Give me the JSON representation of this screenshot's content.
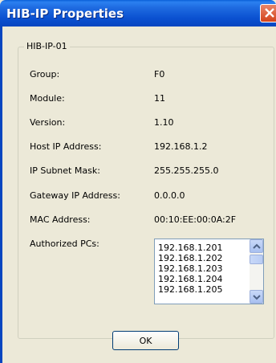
{
  "window": {
    "title": "HIB-IP Properties"
  },
  "group": {
    "caption": "HIB-IP-01",
    "fields": [
      {
        "label": "Group:",
        "value": "F0"
      },
      {
        "label": "Module:",
        "value": "11"
      },
      {
        "label": "Version:",
        "value": "1.10"
      },
      {
        "label": "Host IP Address:",
        "value": "192.168.1.2"
      },
      {
        "label": "IP Subnet Mask:",
        "value": "255.255.255.0"
      },
      {
        "label": "Gateway IP Address:",
        "value": "0.0.0.0"
      },
      {
        "label": "MAC Address:",
        "value": "00:10:EE:00:0A:2F"
      }
    ],
    "authorized_label": "Authorized PCs:",
    "authorized_pcs": [
      "192.168.1.201",
      "192.168.1.202",
      "192.168.1.203",
      "192.168.1.204",
      "192.168.1.205"
    ]
  },
  "buttons": {
    "ok_label": "OK"
  },
  "icons": {
    "close": "close-icon",
    "scroll_up": "chevron-up-icon",
    "scroll_down": "chevron-down-icon"
  }
}
